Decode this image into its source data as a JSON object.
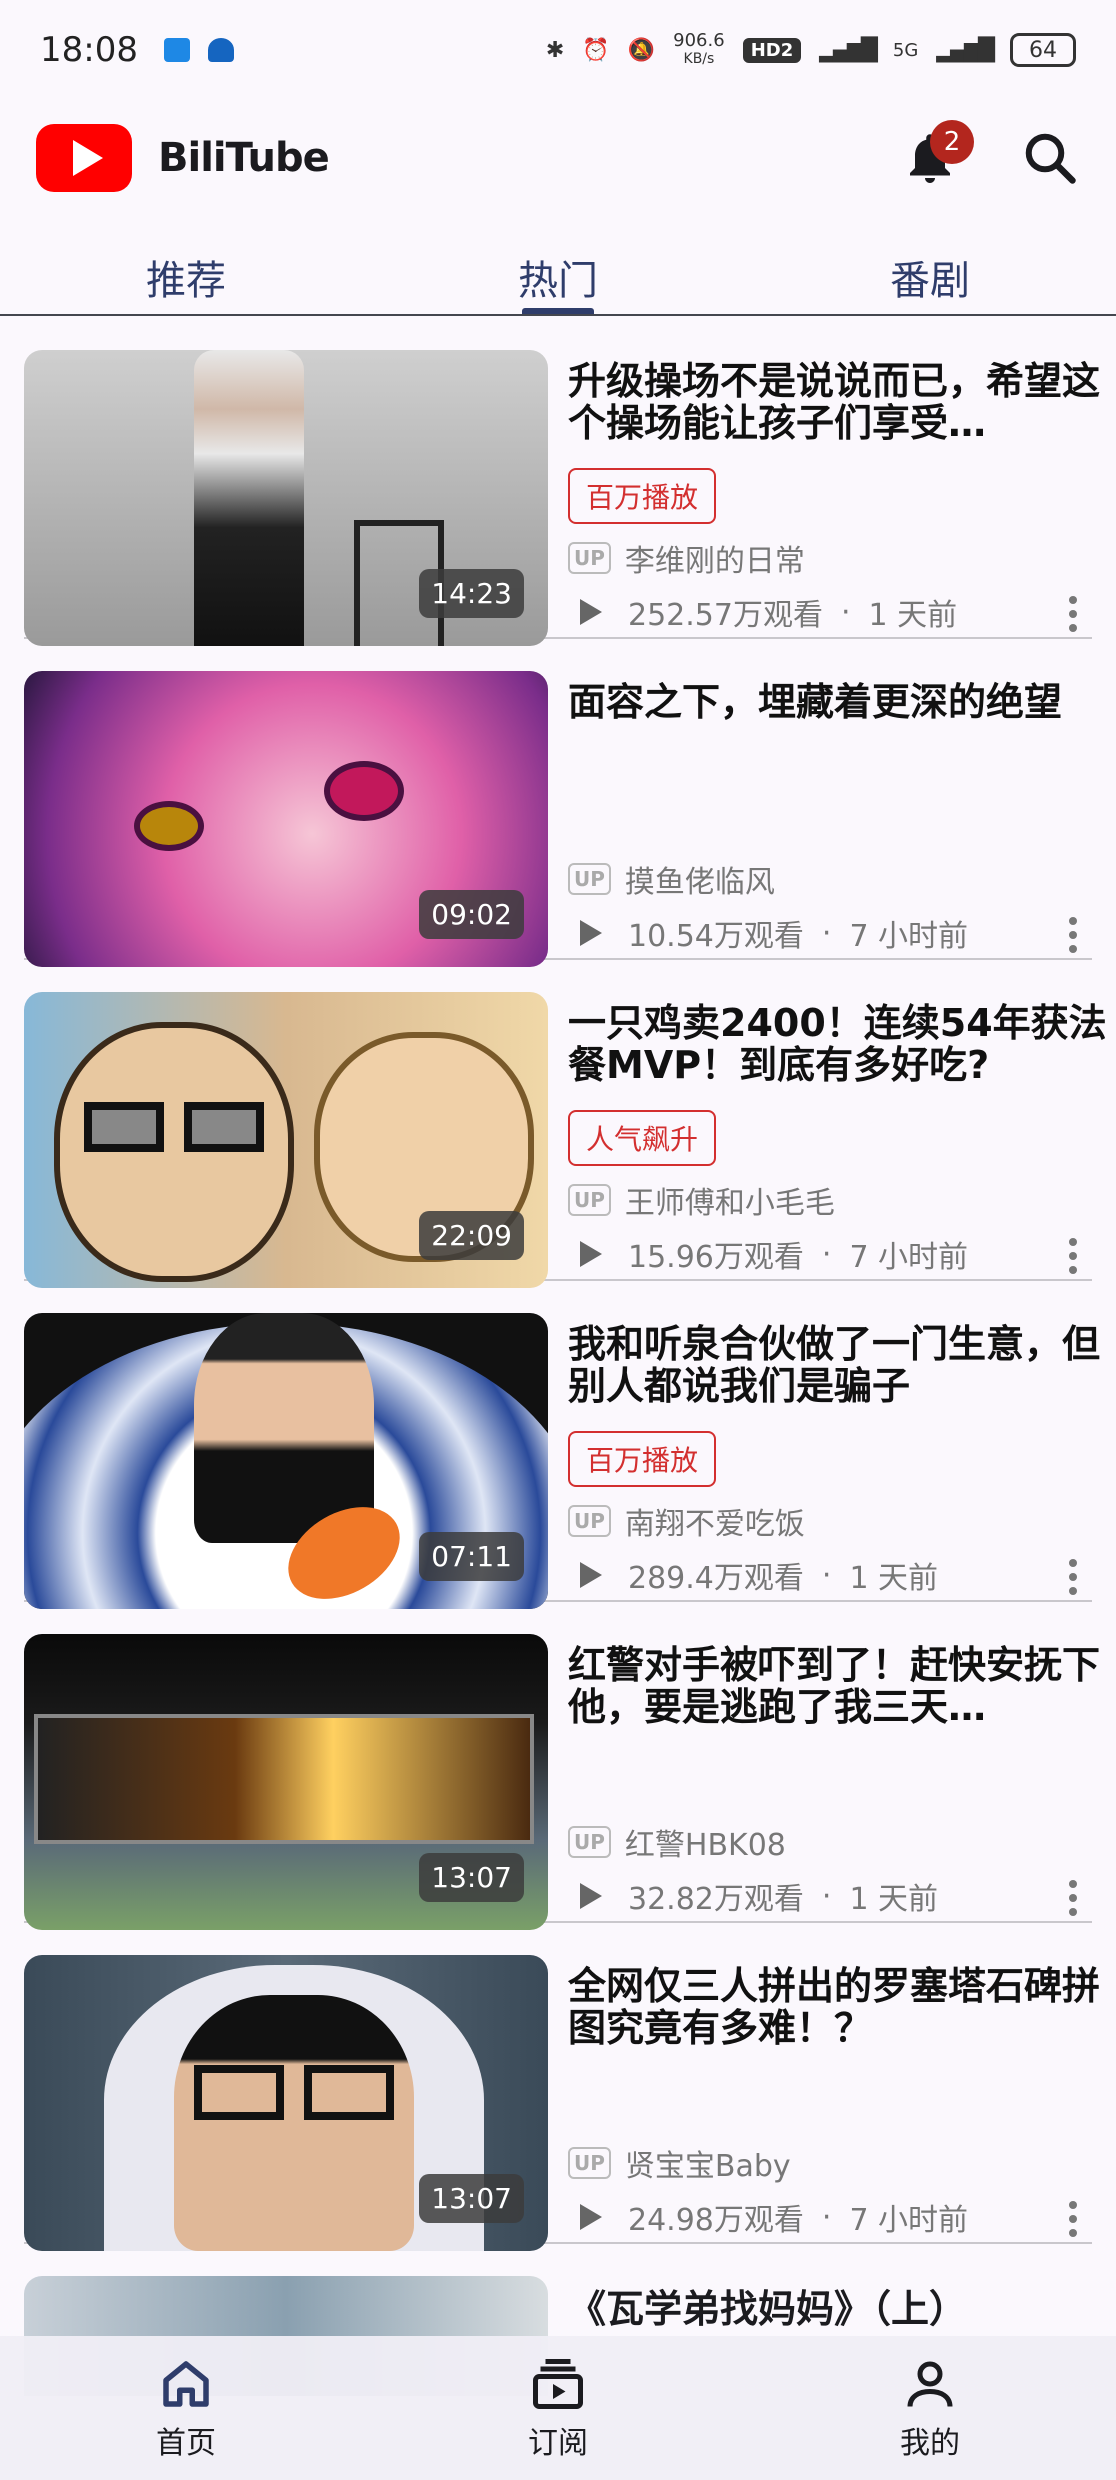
{
  "status_bar": {
    "time": "18:08",
    "speed_value": "906.6",
    "speed_unit": "KB/s",
    "hd": "HD2",
    "network": "5G",
    "battery": "64"
  },
  "app": {
    "name": "BiliTube",
    "notification_count": "2",
    "brand_color": "#ff0000"
  },
  "tabs": [
    {
      "label": "推荐"
    },
    {
      "label": "热门",
      "active": true
    },
    {
      "label": "番剧"
    }
  ],
  "videos": [
    {
      "title": "升级操场不是说说而已，希望这个操场能让孩子们享受…",
      "tag": "百万播放",
      "up_label": "UP",
      "uploader": "李维刚的日常",
      "views": "252.57万观看",
      "time": "1 天前",
      "duration": "14:23"
    },
    {
      "title": "面容之下，埋藏着更深的绝望",
      "tag": "",
      "up_label": "UP",
      "uploader": "摸鱼佬临风",
      "views": "10.54万观看",
      "time": "7 小时前",
      "duration": "09:02"
    },
    {
      "title": "一只鸡卖2400！连续54年获法餐MVP！到底有多好吃?",
      "tag": "人气飙升",
      "up_label": "UP",
      "uploader": "王师傅和小毛毛",
      "views": "15.96万观看",
      "time": "7 小时前",
      "duration": "22:09"
    },
    {
      "title": "我和听泉合伙做了一门生意，但别人都说我们是骗子",
      "tag": "百万播放",
      "up_label": "UP",
      "uploader": "南翔不爱吃饭",
      "views": "289.4万观看",
      "time": "1 天前",
      "duration": "07:11"
    },
    {
      "title": "红警对手被吓到了！赶快安抚下他，要是逃跑了我三天…",
      "tag": "",
      "up_label": "UP",
      "uploader": "红警HBK08",
      "views": "32.82万观看",
      "time": "1 天前",
      "duration": "13:07"
    },
    {
      "title": "全网仅三人拼出的罗塞塔石碑拼图究竟有多难！？",
      "tag": "",
      "up_label": "UP",
      "uploader": "贤宝宝Baby",
      "views": "24.98万观看",
      "time": "7 小时前",
      "duration": "13:07"
    }
  ],
  "partial_video": {
    "title": "《瓦学弟找妈妈》（上）"
  },
  "bottom_nav": [
    {
      "label": "首页",
      "icon": "home-icon"
    },
    {
      "label": "订阅",
      "icon": "subscriptions-icon"
    },
    {
      "label": "我的",
      "icon": "profile-icon"
    }
  ]
}
